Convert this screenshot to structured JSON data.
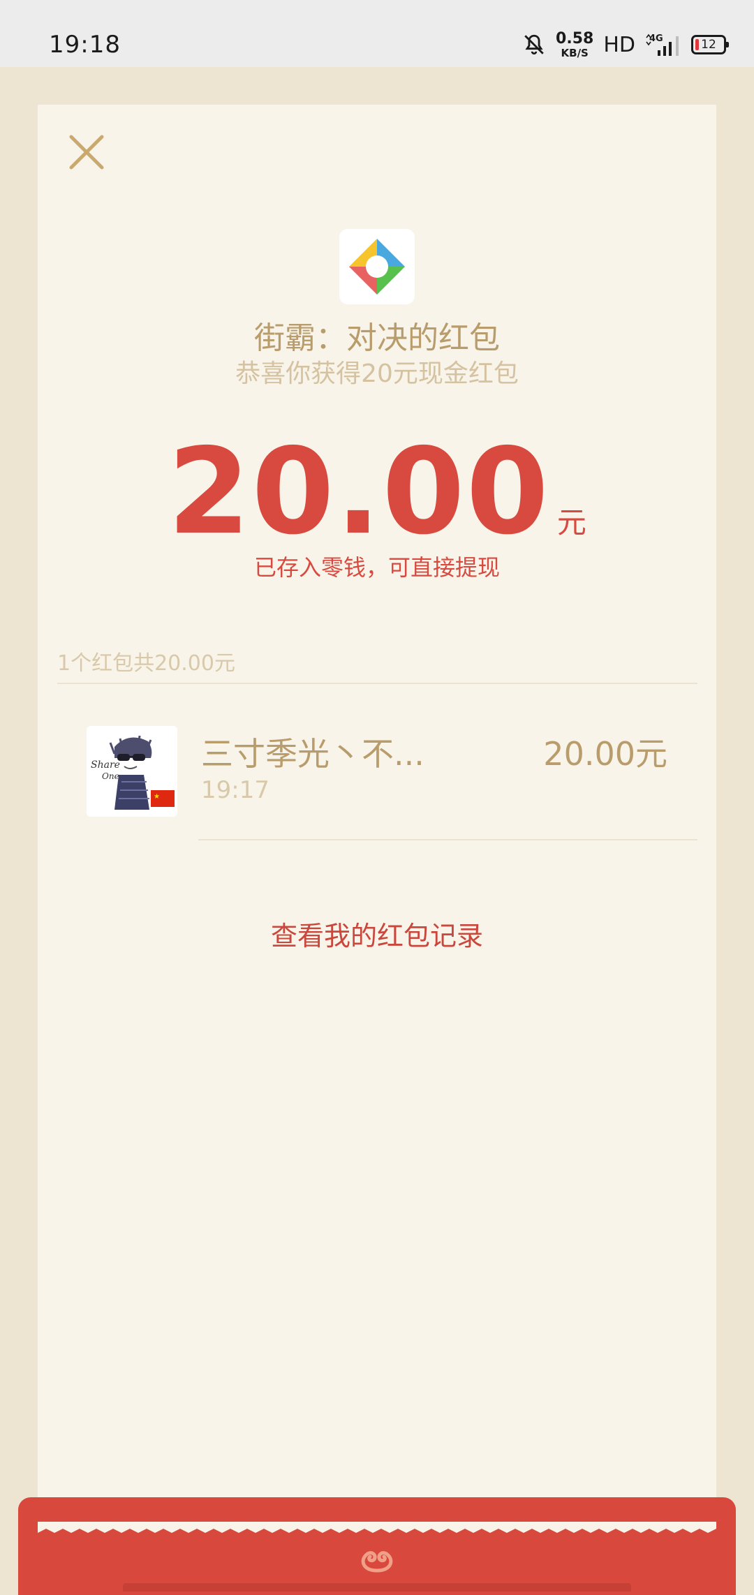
{
  "status_bar": {
    "time": "19:18",
    "net_speed_value": "0.58",
    "net_speed_unit": "KB/S",
    "hd": "HD",
    "network": "4G",
    "battery": "12"
  },
  "header": {
    "title": "街霸：对决的红包",
    "subtitle": "恭喜你获得20元现金红包"
  },
  "amount": {
    "value": "20.00",
    "unit": "元",
    "note": "已存入零钱，可直接提现"
  },
  "summary": "1个红包共20.00元",
  "records": [
    {
      "name": "三寸季光丶不...",
      "time": "19:17",
      "amount": "20.00元"
    }
  ],
  "avatar_text": [
    "Share",
    "One"
  ],
  "records_link": "查看我的红包记录",
  "colors": {
    "accent_red": "#d84a3f",
    "gold_text": "#b89c6c",
    "card_bg": "#f9f4e9"
  }
}
